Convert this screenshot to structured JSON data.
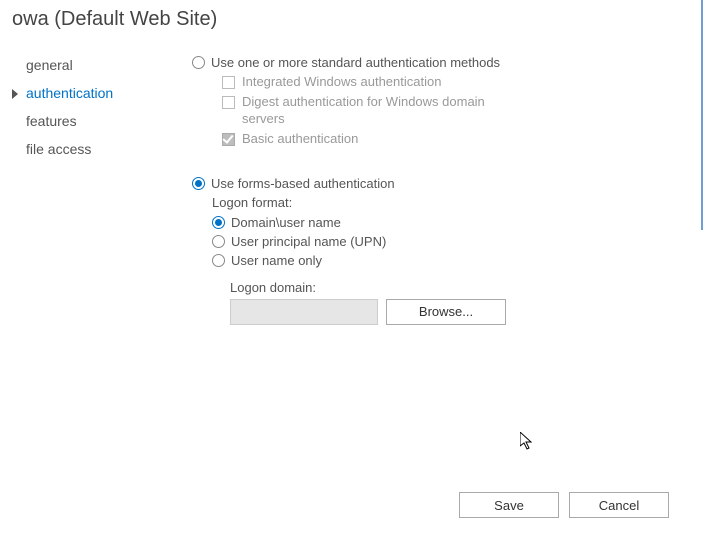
{
  "title": "owa (Default Web Site)",
  "sidebar": {
    "items": [
      {
        "label": "general",
        "active": false
      },
      {
        "label": "authentication",
        "active": true
      },
      {
        "label": "features",
        "active": false
      },
      {
        "label": "file access",
        "active": false
      }
    ]
  },
  "auth": {
    "standard": {
      "label": "Use one or more standard authentication methods",
      "selected": false,
      "options": [
        {
          "label": "Integrated Windows authentication",
          "checked": false
        },
        {
          "label": "Digest authentication for Windows domain servers",
          "checked": false
        },
        {
          "label": "Basic authentication",
          "checked": true
        }
      ]
    },
    "forms": {
      "label": "Use forms-based authentication",
      "selected": true,
      "logon_format_label": "Logon format:",
      "options": [
        {
          "label": "Domain\\user name",
          "selected": true
        },
        {
          "label": "User principal name (UPN)",
          "selected": false
        },
        {
          "label": "User name only",
          "selected": false
        }
      ],
      "logon_domain_label": "Logon domain:",
      "logon_domain_value": "",
      "browse_label": "Browse..."
    }
  },
  "footer": {
    "save": "Save",
    "cancel": "Cancel"
  }
}
